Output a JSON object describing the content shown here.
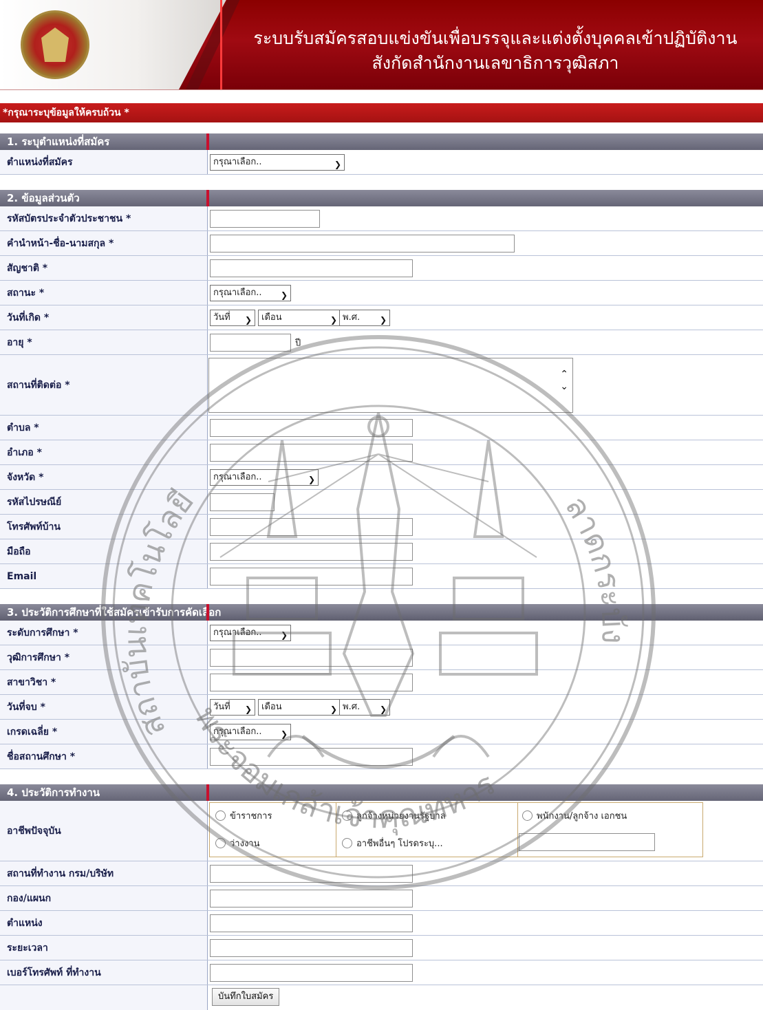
{
  "header": {
    "title_line1": "ระบบรับสมัครสอบแข่งขันเพื่อบรรจุและแต่งตั้งบุคคลเข้าปฏิบัติงาน",
    "title_line2": "สังกัดสำนักงานเลขาธิการวุฒิสภา"
  },
  "notice": "*กรุณาระบุข้อมูลให้ครบถ้วน *",
  "section1": {
    "title": "1. ระบุตำแหน่งที่สมัคร",
    "position_label": "ตำแหน่งที่สมัคร",
    "position_select": "กรุณาเลือก.."
  },
  "section2": {
    "title": "2. ข้อมูลส่วนตัว",
    "id_label": "รหัสบัตรประจำตัวประชาชน *",
    "name_label": "คำนำหน้า-ชื่อ-นามสกุล *",
    "nationality_label": "สัญชาติ *",
    "status_label": "สถานะ *",
    "status_select": "กรุณาเลือก..",
    "birthdate_label": "วันที่เกิด *",
    "birth_day_select": "วันที่",
    "birth_month_select": "เดือน",
    "birth_year_select": "พ.ศ.",
    "age_label": "อายุ *",
    "age_suffix": "ปี",
    "address_label": "สถานที่ติดต่อ *",
    "subdistrict_label": "ตำบล *",
    "district_label": "อำเภอ *",
    "province_label": "จังหวัด *",
    "province_select": "กรุณาเลือก..",
    "postcode_label": "รหัสไปรษณีย์",
    "homephone_label": "โทรศัพท์บ้าน",
    "mobile_label": "มือถือ",
    "email_label": "Email"
  },
  "section3": {
    "title": "3. ประวัติการศึกษาที่ใช้สมัครเข้ารับการคัดเลือก",
    "level_label": "ระดับการศึกษา *",
    "level_select": "กรุณาเลือก..",
    "degree_label": "วุฒิการศึกษา *",
    "major_label": "สาขาวิชา *",
    "graddate_label": "วันที่จบ *",
    "grad_day_select": "วันที่",
    "grad_month_select": "เดือน",
    "grad_year_select": "พ.ศ.",
    "gpa_label": "เกรดเฉลี่ย *",
    "gpa_select": "กรุณาเลือก..",
    "school_label": "ชื่อสถานศึกษา *"
  },
  "section4": {
    "title": "4. ประวัติการทำงาน",
    "occupation_label": "อาชีพปัจจุบัน",
    "opt_civil": "ข้าราชการ",
    "opt_govemp": "ลูกจ้างหน่วยงานรัฐบาล",
    "opt_private": "พนักงาน/ลูกจ้าง เอกชน",
    "opt_unemployed": "ว่างงาน",
    "opt_other": "อาชีพอื่นๆ โปรดระบุ...",
    "workplace_label": "สถานที่ทำงาน กรม/บริษัท",
    "division_label": "กอง/แผนก",
    "jobpos_label": "ตำแหน่ง",
    "duration_label": "ระยะเวลา",
    "workphone_label": "เบอร์โทรศัพท์ ที่ทำงาน"
  },
  "submit_label": "บันทึกใบสมัคร",
  "watermark": {
    "bottom_text": "พระจอมเกล้าเจ้าคุณทหาร",
    "left_text": "สถาบันเทคโนโลยี",
    "right_text": "ลาดกระบัง"
  }
}
